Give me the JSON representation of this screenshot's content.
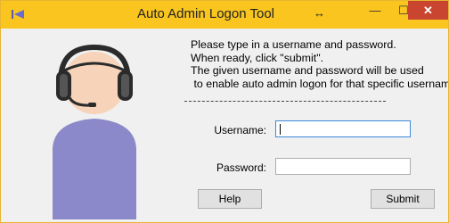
{
  "window": {
    "title": "Auto Admin Logon Tool",
    "app_icon": "media-back-icon",
    "resize_icon": "↔",
    "minimize_label": "—",
    "maximize_label": "☐",
    "close_label": "✕",
    "titlebar_color": "#f9c51e",
    "close_color": "#c9452f"
  },
  "instructions": [
    "Please type in a username and password.",
    "When ready, click \"submit\".",
    "The given username and password will be used",
    " to enable auto admin logon for that specific username."
  ],
  "divider": "--------------------------------------------------------------------",
  "form": {
    "username_label": "Username:",
    "username_value": "",
    "password_label": "Password:",
    "password_value": ""
  },
  "buttons": {
    "help": "Help",
    "submit": "Submit"
  },
  "avatar": {
    "icon": "support-agent-headset-icon",
    "skin_color": "#f6d3b9",
    "body_color": "#8b89c9",
    "headset_color": "#2b2b2b"
  }
}
